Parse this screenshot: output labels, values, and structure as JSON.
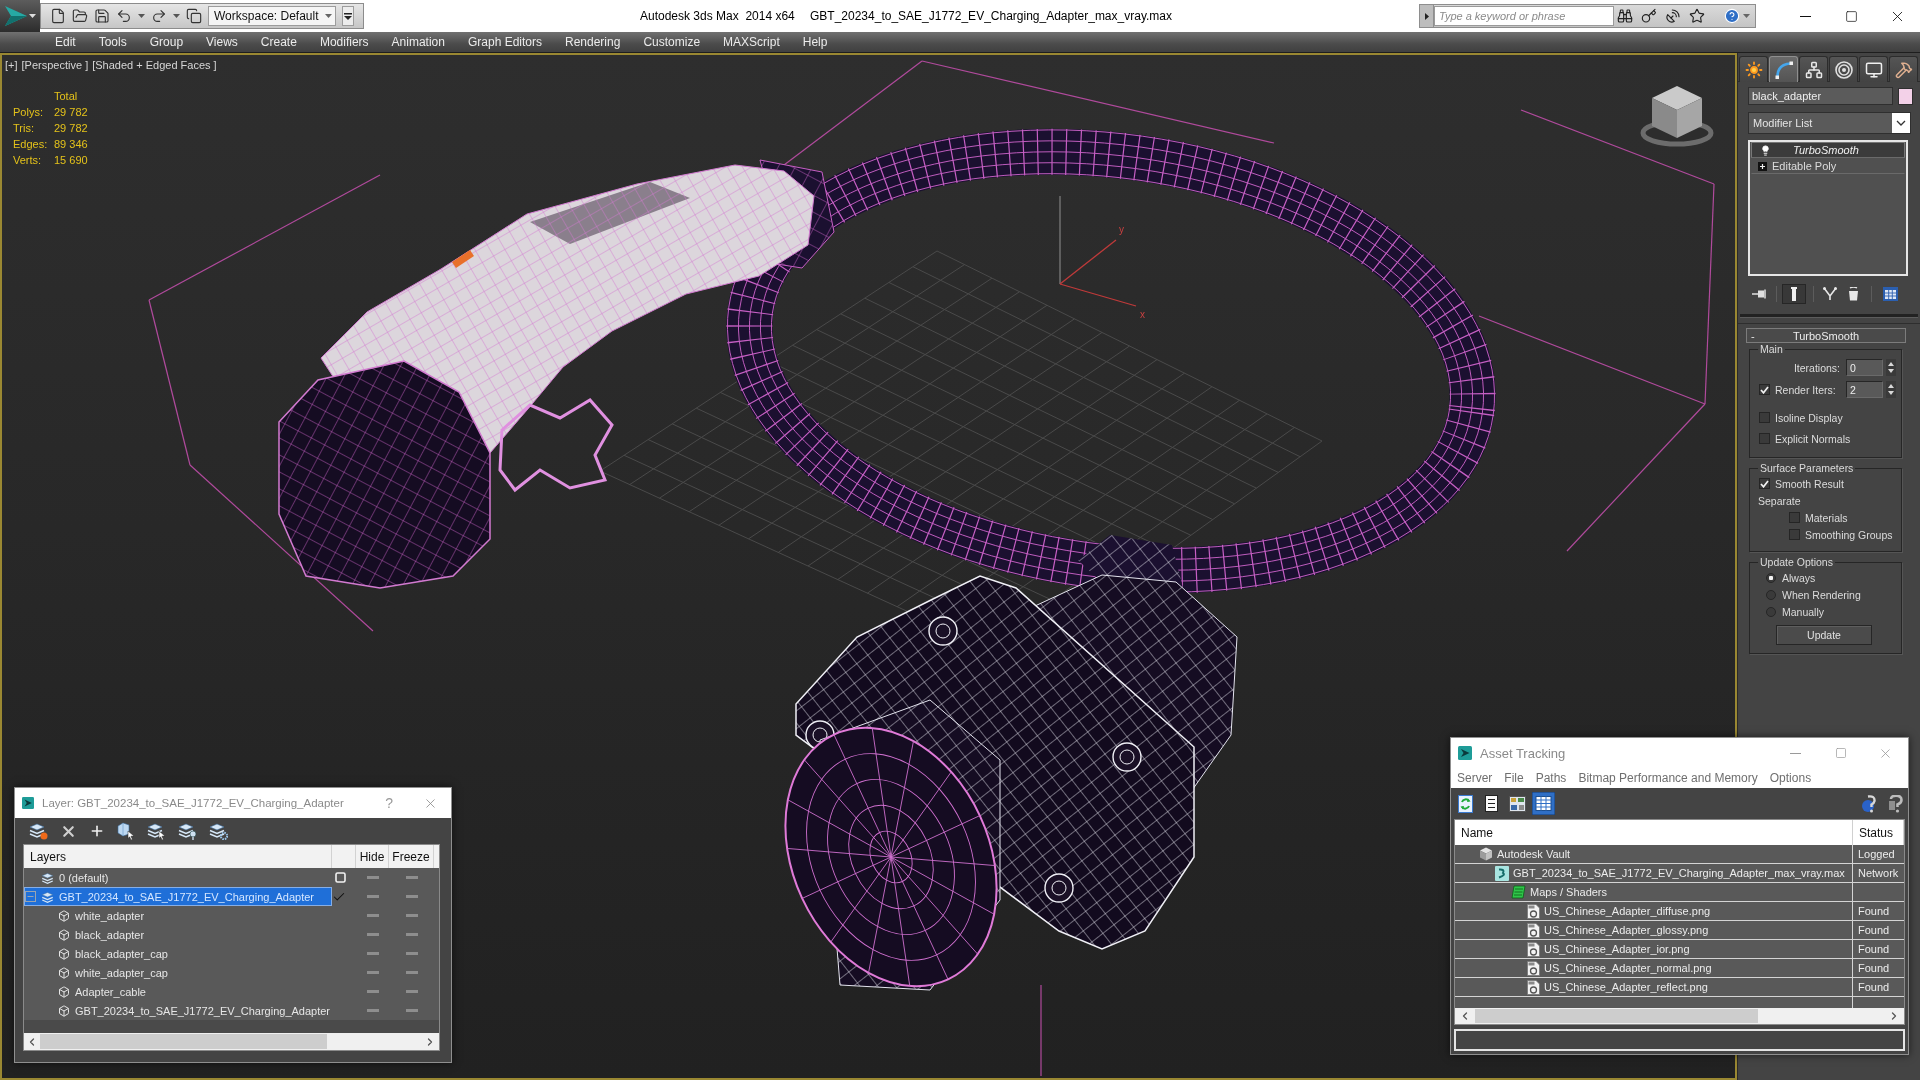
{
  "title_bar": {
    "workspace": "Workspace: Default",
    "app_name": "Autodesk 3ds Max  2014 x64",
    "file_name": "GBT_20234_to_SAE_J1772_EV_Charging_Adapter_max_vray.max",
    "search": {
      "placeholder": "Type a keyword or phrase"
    }
  },
  "menu": [
    "Edit",
    "Tools",
    "Group",
    "Views",
    "Create",
    "Modifiers",
    "Animation",
    "Graph Editors",
    "Rendering",
    "Customize",
    "MAXScript",
    "Help"
  ],
  "viewport": {
    "active": true,
    "labels": [
      "[+]",
      "[Perspective ]",
      "[Shaded + Edged Faces ]"
    ],
    "stats": {
      "header": "Total",
      "rows": [
        {
          "label": "Polys:",
          "value": "29 782"
        },
        {
          "label": "Tris:",
          "value": "29 782"
        },
        {
          "label": "Edges:",
          "value": "89 346"
        },
        {
          "label": "Verts:",
          "value": "15 690"
        }
      ]
    },
    "axis_labels": [
      "y",
      "x"
    ]
  },
  "command_panel": {
    "tabs": [
      {
        "kind": "create",
        "selected": false
      },
      {
        "kind": "modify",
        "selected": true
      },
      {
        "kind": "hierarchy",
        "selected": false
      },
      {
        "kind": "motion",
        "selected": false
      },
      {
        "kind": "display",
        "selected": false
      },
      {
        "kind": "utilities",
        "selected": false
      }
    ],
    "object": {
      "name": "black_adapter",
      "color": "#f3d1e8"
    },
    "modifier_list": "Modifier List",
    "stack": [
      {
        "name": "TurboSmooth",
        "kind": "modifier",
        "selected": true,
        "viewport_off": true
      },
      {
        "name": "Editable Poly",
        "kind": "base",
        "selected": false,
        "viewport_off": false
      }
    ],
    "rollout": {
      "toggle": "-",
      "title": "TurboSmooth",
      "groups": [
        {
          "title": "Main",
          "controls": [
            {
              "kind": "spinner",
              "label": "Iterations:",
              "value": "0"
            },
            {
              "kind": "check_spinner",
              "label": "Render Iters:",
              "checked": true,
              "value": "2"
            },
            {
              "kind": "checkbox",
              "label": "Isoline Display",
              "checked": false
            },
            {
              "kind": "checkbox",
              "label": "Explicit Normals",
              "checked": false
            }
          ]
        },
        {
          "title": "Surface Parameters",
          "controls": [
            {
              "kind": "checkbox",
              "label": "Smooth Result",
              "checked": true
            },
            {
              "kind": "label",
              "label": "Separate"
            },
            {
              "kind": "sub_checkbox",
              "label": "Materials",
              "checked": false
            },
            {
              "kind": "sub_checkbox",
              "label": "Smoothing Groups",
              "checked": false
            }
          ]
        },
        {
          "title": "Update Options",
          "controls": [
            {
              "kind": "radio",
              "label": "Always",
              "selected": true
            },
            {
              "kind": "radio",
              "label": "When Rendering",
              "selected": false
            },
            {
              "kind": "radio",
              "label": "Manually",
              "selected": false
            },
            {
              "kind": "button",
              "label": "Update"
            }
          ]
        }
      ]
    }
  },
  "layer_dialog": {
    "title": "Layer: GBT_20234_to_SAE_J1772_EV_Charging_Adapter",
    "help": "?",
    "columns": [
      "Layers",
      "Hide",
      "Freeze"
    ],
    "layers": [
      {
        "name": "0 (default)",
        "kind": "layer",
        "selected": false,
        "current": false,
        "hidden": false,
        "frozen": false
      },
      {
        "name": "GBT_20234_to_SAE_J1772_EV_Charging_Adapter",
        "kind": "layer",
        "selected": true,
        "current": true,
        "expanded": true,
        "hidden": false,
        "frozen": false,
        "children": [
          {
            "name": "white_adapter",
            "kind": "object",
            "selected": false,
            "hidden": false,
            "frozen": false
          },
          {
            "name": "black_adapter",
            "kind": "object",
            "selected": false,
            "hidden": false,
            "frozen": false
          },
          {
            "name": "black_adapter_cap",
            "kind": "object",
            "selected": false,
            "hidden": false,
            "frozen": false
          },
          {
            "name": "white_adapter_cap",
            "kind": "object",
            "selected": false,
            "hidden": false,
            "frozen": false
          },
          {
            "name": "Adapter_cable",
            "kind": "object",
            "selected": false,
            "hidden": false,
            "frozen": false
          },
          {
            "name": "GBT_20234_to_SAE_J1772_EV_Charging_Adapter",
            "kind": "object",
            "selected": false,
            "hidden": false,
            "frozen": false
          }
        ]
      }
    ]
  },
  "asset_tracking": {
    "title": "Asset Tracking",
    "menu": [
      "Server",
      "File",
      "Paths",
      "Bitmap Performance and Memory",
      "Options"
    ],
    "toolbar": [
      {
        "kind": "refresh",
        "selected": false
      },
      {
        "kind": "list",
        "selected": false
      },
      {
        "kind": "thumbnails",
        "selected": false
      },
      {
        "kind": "table",
        "selected": true
      }
    ],
    "columns": [
      "Name",
      "Status"
    ],
    "assets": [
      {
        "name": "Autodesk Vault",
        "kind": "vault",
        "status": "Logged",
        "children": [
          {
            "name": "GBT_20234_to_SAE_J1772_EV_Charging_Adapter_max_vray.max",
            "kind": "scene",
            "status": "Network",
            "children": [
              {
                "name": "Maps / Shaders",
                "kind": "folder",
                "children": [
                  {
                    "name": "US_Chinese_Adapter_diffuse.png",
                    "kind": "bitmap",
                    "status": "Found"
                  },
                  {
                    "name": "US_Chinese_Adapter_glossy.png",
                    "kind": "bitmap",
                    "status": "Found"
                  },
                  {
                    "name": "US_Chinese_Adapter_ior.png",
                    "kind": "bitmap",
                    "status": "Found"
                  },
                  {
                    "name": "US_Chinese_Adapter_normal.png",
                    "kind": "bitmap",
                    "status": "Found"
                  },
                  {
                    "name": "US_Chinese_Adapter_reflect.png",
                    "kind": "bitmap",
                    "status": "Found"
                  }
                ]
              }
            ]
          }
        ]
      }
    ]
  }
}
